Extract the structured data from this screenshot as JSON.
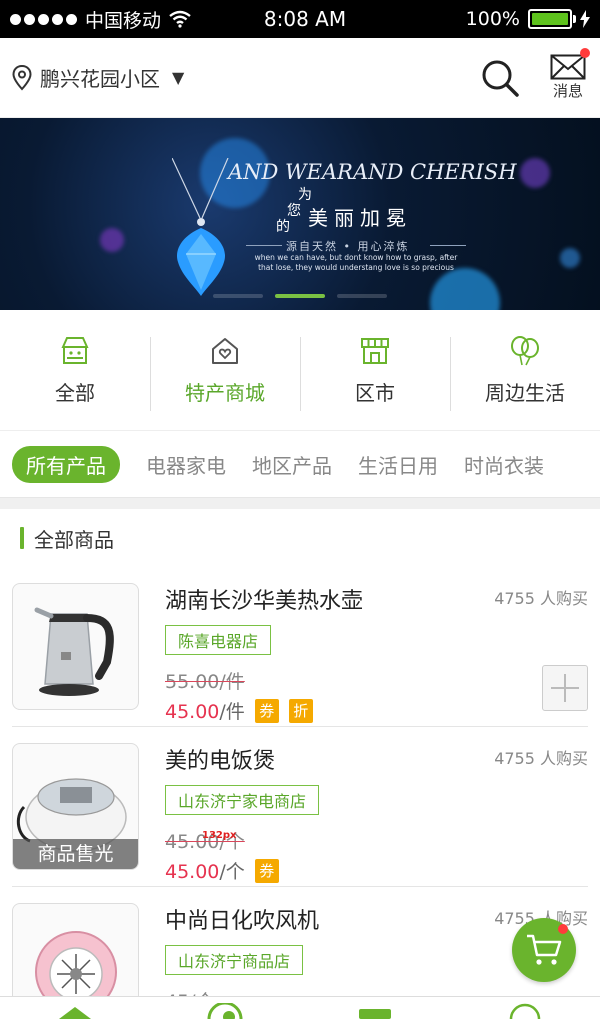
{
  "status_bar": {
    "carrier": "中国移动",
    "time": "8:08 AM",
    "battery": "100%"
  },
  "header": {
    "location": "鹏兴花园小区",
    "location_icon": "map-pin-icon",
    "search_icon": "search-icon",
    "message_label": "消息"
  },
  "banner": {
    "headline": "AND WEARAND CHERISH",
    "small_1": "为",
    "small_2": "您",
    "small_3": "的",
    "title": "美丽加冕",
    "subtitle": "源自天然  •  用心淬炼",
    "tagline": "when we can have, but dont know how to grasp, after that lose, they would understang love is so precious",
    "page_index": 2,
    "page_count": 3
  },
  "categories": [
    {
      "label": "全部",
      "icon": "shop-icon"
    },
    {
      "label": "特产商城",
      "icon": "home-heart-icon"
    },
    {
      "label": "区市",
      "icon": "market-stall-icon"
    },
    {
      "label": "周边生活",
      "icon": "balloons-icon"
    }
  ],
  "tabs": [
    "所有产品",
    "电器家电",
    "地区产品",
    "生活日用",
    "时尚衣装"
  ],
  "section_title": "全部商品",
  "products": [
    {
      "name": "湖南长沙华美热水壶",
      "shop": "陈喜电器店",
      "old_price": "55.00/件",
      "price": "45.00",
      "unit": "/件",
      "tags": [
        "券",
        "折"
      ],
      "sold": "4755 人购买",
      "soldout": ""
    },
    {
      "name": "美的电饭煲",
      "shop": "山东济宁家电商店",
      "old_price": "45.00/个",
      "price": "45.00",
      "unit": "/个",
      "tags": [
        "券"
      ],
      "sold": "4755 人购买",
      "soldout": "商品售光"
    },
    {
      "name": "中尚日化吹风机",
      "shop": "山东济宁商品店",
      "old_price": "45/个",
      "price": "",
      "unit": "",
      "tags": [],
      "sold": "4755 人购买",
      "soldout": ""
    }
  ],
  "annotation": "132px",
  "colors": {
    "accent": "#6ab42d",
    "price": "#e6334f",
    "tag": "#f5a900",
    "badge": "#ff3b3b"
  }
}
